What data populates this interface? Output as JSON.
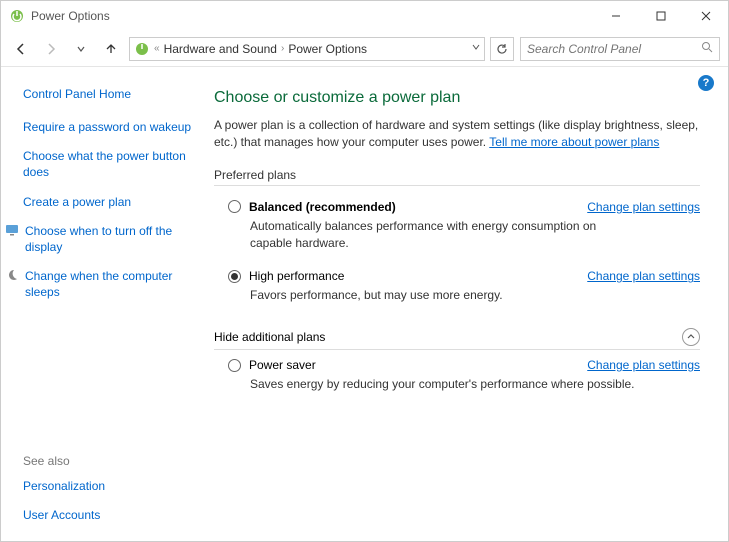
{
  "window": {
    "title": "Power Options"
  },
  "breadcrumb": {
    "ellipsis": "«",
    "item1": "Hardware and Sound",
    "item2": "Power Options"
  },
  "search": {
    "placeholder": "Search Control Panel"
  },
  "sidebar": {
    "home": "Control Panel Home",
    "links": {
      "l0": "Require a password on wakeup",
      "l1": "Choose what the power button does",
      "l2": "Create a power plan",
      "l3": "Choose when to turn off the display",
      "l4": "Change when the computer sleeps"
    },
    "see_also_label": "See also",
    "see_also": {
      "s0": "Personalization",
      "s1": "User Accounts"
    }
  },
  "main": {
    "title": "Choose or customize a power plan",
    "intro": "A power plan is a collection of hardware and system settings (like display brightness, sleep, etc.) that manages how your computer uses power. ",
    "intro_link": "Tell me more about power plans",
    "preferred_label": "Preferred plans",
    "hide_label": "Hide additional plans",
    "change_label": "Change plan settings",
    "plans": {
      "balanced": {
        "name": "Balanced (recommended)",
        "desc": "Automatically balances performance with energy consumption on capable hardware."
      },
      "high": {
        "name": "High performance",
        "desc": "Favors performance, but may use more energy."
      },
      "saver": {
        "name": "Power saver",
        "desc": "Saves energy by reducing your computer's performance where possible."
      }
    }
  }
}
